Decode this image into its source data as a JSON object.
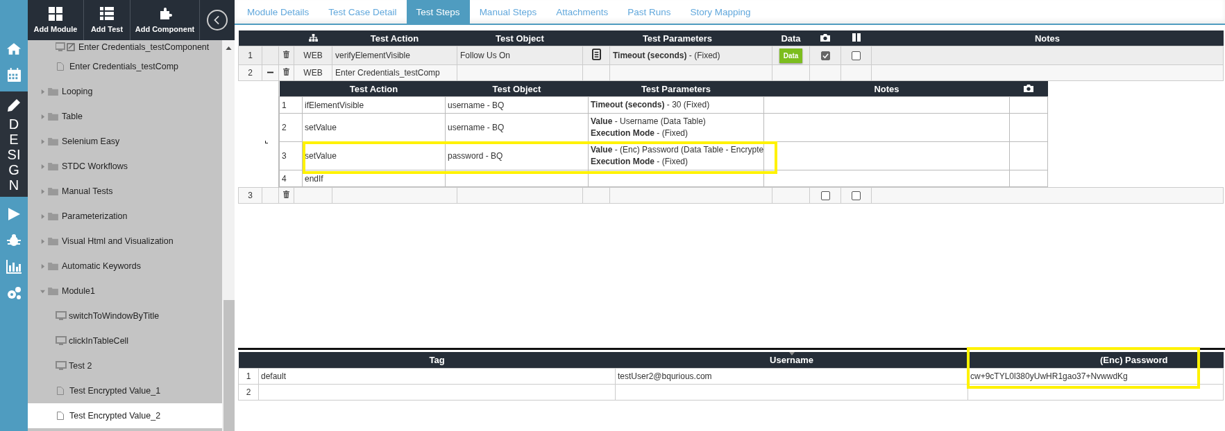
{
  "rail": {
    "section_label": "DESIGN"
  },
  "toolbar": {
    "buttons": [
      {
        "label": "Add Module",
        "kind": "module"
      },
      {
        "label": "Add Test",
        "kind": "test"
      },
      {
        "label": "Add Component",
        "kind": "component"
      }
    ]
  },
  "tree": {
    "orphan_children": [
      {
        "label": "Enter Credentials_testComponent",
        "kind": "component",
        "selected": false
      },
      {
        "label": "Enter Credentials_testComp",
        "kind": "test",
        "selected": false
      }
    ],
    "items": [
      {
        "label": "Looping",
        "kind": "folder",
        "expanded": false
      },
      {
        "label": "Table",
        "kind": "folder",
        "expanded": false
      },
      {
        "label": "Selenium Easy",
        "kind": "folder",
        "expanded": false
      },
      {
        "label": "STDC Workflows",
        "kind": "folder",
        "expanded": false
      },
      {
        "label": "Manual Tests",
        "kind": "folder",
        "expanded": false
      },
      {
        "label": "Parameterization",
        "kind": "folder",
        "expanded": false
      },
      {
        "label": "Visual Html and Visualization",
        "kind": "folder",
        "expanded": false
      },
      {
        "label": "Automatic Keywords",
        "kind": "folder",
        "expanded": false
      },
      {
        "label": "Module1",
        "kind": "folder",
        "expanded": true,
        "children": [
          {
            "label": "switchToWindowByTitle",
            "kind": "screen",
            "selected": false
          },
          {
            "label": "clickInTableCell",
            "kind": "screen",
            "selected": false
          },
          {
            "label": "Test 2",
            "kind": "screen",
            "selected": false
          },
          {
            "label": "Test Encrypted Value_1",
            "kind": "test",
            "selected": false
          },
          {
            "label": "Test Encrypted Value_2",
            "kind": "test",
            "selected": true
          }
        ]
      }
    ]
  },
  "tabs": [
    {
      "label": "Module Details",
      "selected": false
    },
    {
      "label": "Test Case Detail",
      "selected": false
    },
    {
      "label": "Test Steps",
      "selected": true
    },
    {
      "label": "Manual Steps",
      "selected": false
    },
    {
      "label": "Attachments",
      "selected": false
    },
    {
      "label": "Past Runs",
      "selected": false
    },
    {
      "label": "Story Mapping",
      "selected": false
    }
  ],
  "steps": {
    "columns": [
      "Test Action",
      "Test Object",
      "Test Parameters",
      "Data",
      "Notes"
    ],
    "rows": [
      {
        "number": "1",
        "platform": "WEB",
        "action": "verifyElementVisible",
        "object": "Follow Us On",
        "has_object_doc": true,
        "params": [
          "**Timeout (seconds)** -  (Fixed)"
        ],
        "data_button": "Data",
        "show_checks": true,
        "screenshot": true,
        "pause": false
      },
      {
        "number": "2",
        "platform": "WEB",
        "action": "Enter Credentials_testComp",
        "has_object_doc": false,
        "show_checks": false,
        "expanded": true,
        "sub_columns": [
          "Test Action",
          "Test Object",
          "Test Parameters",
          "Notes"
        ],
        "children": [
          {
            "number": "1",
            "action": "ifElementVisible",
            "object": "username  - BQ",
            "params": [
              "**Timeout (seconds)** - 30 (Fixed)"
            ]
          },
          {
            "number": "2",
            "action": "setValue",
            "object": "username  - BQ",
            "params": [
              "**Value** - Username (Data Table)",
              "**Execution Mode** -  (Fixed)"
            ]
          },
          {
            "number": "3",
            "action": "setValue",
            "object": "password - BQ",
            "params": [
              "**Value** - (Enc) Password (Data Table - Encrypte",
              "**Execution Mode** -  (Fixed)"
            ]
          },
          {
            "number": "4",
            "action": "endIf"
          }
        ]
      },
      {
        "number": "3",
        "has_object_doc": false,
        "show_checks": true,
        "screenshot": false,
        "pause": false
      }
    ]
  },
  "data_table": {
    "columns": [
      "Tag",
      "Username",
      "(Enc) Password"
    ],
    "rows": [
      {
        "number": "1",
        "cells": [
          "default",
          "testUser2@bqurious.com",
          "cw+9cTYL0l380yUwHR1gao37+NvwwdKg"
        ]
      },
      {
        "number": "2",
        "cells": [
          null,
          null,
          null
        ]
      }
    ]
  }
}
